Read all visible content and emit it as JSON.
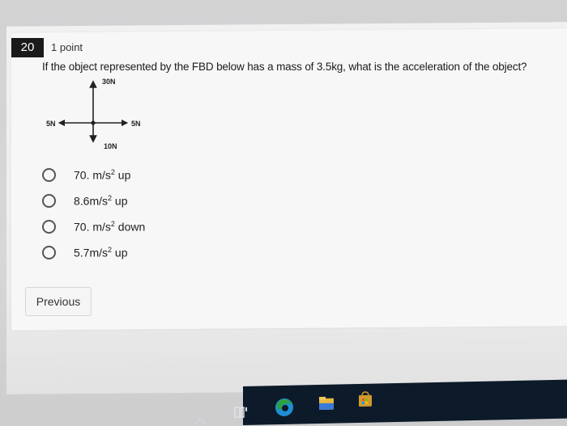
{
  "question": {
    "number": "20",
    "points": "1 point",
    "text": "If the object represented by the FBD below has a mass of 3.5kg, what is the acceleration of the object?"
  },
  "diagram": {
    "force_up": "30N",
    "force_left": "5N",
    "force_right": "5N",
    "force_down": "10N"
  },
  "options": [
    {
      "value": "70. m/s",
      "exp": "2",
      "dir": " up"
    },
    {
      "value": "8.6m/s",
      "exp": "2",
      "dir": " up"
    },
    {
      "value": "70. m/s",
      "exp": "2",
      "dir": " down"
    },
    {
      "value": "5.7m/s",
      "exp": "2",
      "dir": " up"
    }
  ],
  "nav": {
    "previous": "Previous"
  },
  "colors": {
    "qnum_bg": "#1a1a1a",
    "card_bg": "#f7f7f7",
    "taskbar_bg": "#0d1a2a",
    "icon_edge_green": "#2ea043",
    "icon_store_gold": "#d29a2e"
  },
  "taskbar": {
    "icons": [
      "task-view-icon",
      "edge-icon",
      "file-explorer-icon",
      "store-icon"
    ]
  }
}
